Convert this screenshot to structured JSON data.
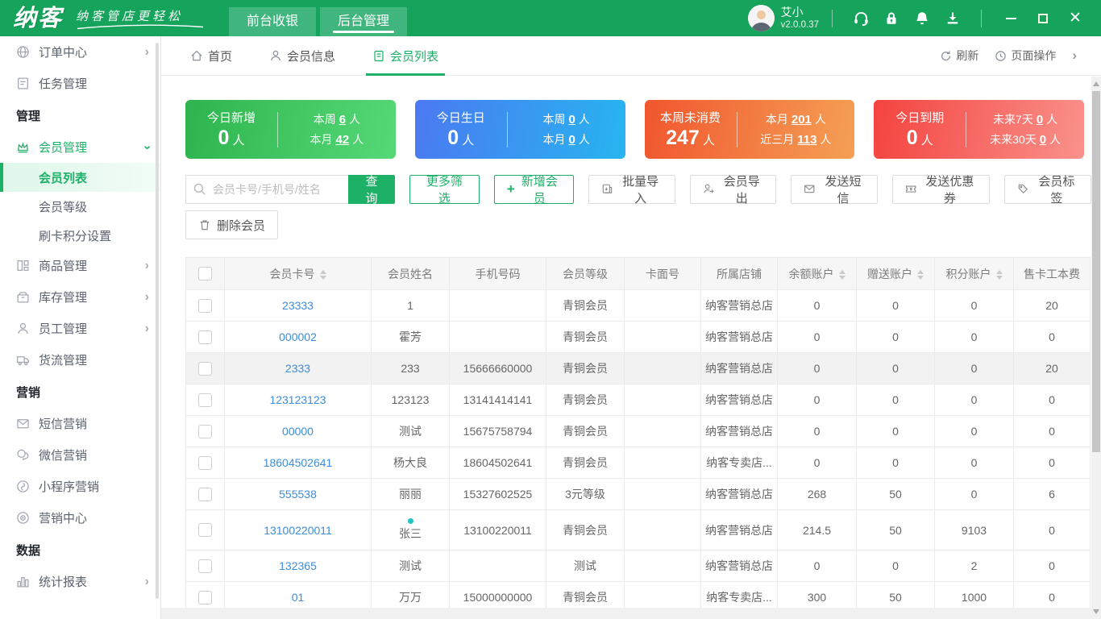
{
  "header": {
    "logo": "纳客",
    "tagline": "纳客管店更轻松",
    "nav": [
      {
        "label": "前台收银"
      },
      {
        "label": "后台管理"
      }
    ],
    "user_name": "艾小",
    "version": "v2.0.0.37"
  },
  "tabbar": {
    "tabs": [
      {
        "label": "首页"
      },
      {
        "label": "会员信息"
      },
      {
        "label": "会员列表"
      }
    ],
    "refresh": "刷新",
    "page_ops": "页面操作"
  },
  "sidebar": {
    "items": [
      {
        "type": "item",
        "key": "order-center",
        "icon": "globe-icon",
        "label": "订单中心",
        "chevron": true
      },
      {
        "type": "item",
        "key": "task-management",
        "icon": "document-icon",
        "label": "任务管理"
      },
      {
        "type": "section",
        "key": "management-section",
        "label": "管理"
      },
      {
        "type": "item",
        "key": "member-management",
        "icon": "crown-icon",
        "label": "会员管理",
        "chevron": true,
        "open": true
      },
      {
        "type": "subitem",
        "key": "member-list",
        "label": "会员列表",
        "active": true
      },
      {
        "type": "subitem",
        "key": "member-level",
        "label": "会员等级"
      },
      {
        "type": "subitem",
        "key": "card-points-setting",
        "label": "刷卡积分设置"
      },
      {
        "type": "item",
        "key": "goods-management",
        "icon": "goods-icon",
        "label": "商品管理",
        "chevron": true
      },
      {
        "type": "item",
        "key": "inventory-management",
        "icon": "box-icon",
        "label": "库存管理",
        "chevron": true
      },
      {
        "type": "item",
        "key": "staff-management",
        "icon": "person-icon",
        "label": "员工管理",
        "chevron": true
      },
      {
        "type": "item",
        "key": "logistics-management",
        "icon": "truck-icon",
        "label": "货流管理"
      },
      {
        "type": "section",
        "key": "marketing-section",
        "label": "营销"
      },
      {
        "type": "item",
        "key": "sms-marketing",
        "icon": "envelope-icon",
        "label": "短信营销"
      },
      {
        "type": "item",
        "key": "wechat-marketing",
        "icon": "wechat-icon",
        "label": "微信营销"
      },
      {
        "type": "item",
        "key": "miniapp-marketing",
        "icon": "miniapp-icon",
        "label": "小程序营销"
      },
      {
        "type": "item",
        "key": "marketing-center",
        "icon": "target-icon",
        "label": "营销中心"
      },
      {
        "type": "section",
        "key": "data-section",
        "label": "数据"
      },
      {
        "type": "item",
        "key": "statistics-report",
        "icon": "chart-icon",
        "label": "统计报表",
        "chevron": true
      }
    ]
  },
  "cards": [
    {
      "theme": "green",
      "title": "今日新增",
      "value": "0",
      "unit": "人",
      "stats": [
        {
          "label": "本周",
          "value": "6",
          "unit": "人"
        },
        {
          "label": "本月",
          "value": "42",
          "unit": "人"
        }
      ]
    },
    {
      "theme": "blue",
      "title": "今日生日",
      "value": "0",
      "unit": "人",
      "stats": [
        {
          "label": "本周",
          "value": "0",
          "unit": "人"
        },
        {
          "label": "本月",
          "value": "0",
          "unit": "人"
        }
      ]
    },
    {
      "theme": "orange",
      "title": "本周未消费",
      "value": "247",
      "unit": "人",
      "stats": [
        {
          "label": "本月",
          "value": "201",
          "unit": "人"
        },
        {
          "label": "近三月",
          "value": "113",
          "unit": "人"
        }
      ]
    },
    {
      "theme": "red",
      "title": "今日到期",
      "value": "0",
      "unit": "人",
      "stats": [
        {
          "label": "未来7天",
          "value": "0",
          "unit": "人"
        },
        {
          "label": "未来30天",
          "value": "0",
          "unit": "人"
        }
      ]
    }
  ],
  "toolbar": {
    "search_placeholder": "会员卡号/手机号/姓名",
    "query": "查询",
    "more_filter": "更多筛选",
    "add_plus": "+",
    "add_member": "新增会员",
    "batch_import": "批量导入",
    "member_export": "会员导出",
    "send_sms": "发送短信",
    "send_coupon": "发送优惠券",
    "member_tag": "会员标签",
    "delete_member": "删除会员"
  },
  "table": {
    "headers": [
      {
        "label": "会员卡号",
        "sortable": true
      },
      {
        "label": "会员姓名"
      },
      {
        "label": "手机号码"
      },
      {
        "label": "会员等级"
      },
      {
        "label": "卡面号"
      },
      {
        "label": "所属店铺"
      },
      {
        "label": "余额账户",
        "sortable": true
      },
      {
        "label": "赠送账户",
        "sortable": true
      },
      {
        "label": "积分账户",
        "sortable": true
      },
      {
        "label": "售卡工本费"
      }
    ],
    "rows": [
      {
        "card_no": "23333",
        "name": "1",
        "phone": "",
        "level": "青铜会员",
        "card_face": "",
        "store": "纳客营销总店",
        "balance": "0",
        "gift": "0",
        "points": "0",
        "fee": "20"
      },
      {
        "card_no": "000002",
        "name": "霍芳",
        "phone": "",
        "level": "青铜会员",
        "card_face": "",
        "store": "纳客营销总店",
        "balance": "0",
        "gift": "0",
        "points": "0",
        "fee": "0"
      },
      {
        "card_no": "2333",
        "name": "233",
        "phone": "15666660000",
        "level": "青铜会员",
        "card_face": "",
        "store": "纳客营销总店",
        "balance": "0",
        "gift": "0",
        "points": "0",
        "fee": "20",
        "shaded": true
      },
      {
        "card_no": "123123123",
        "name": "123123",
        "phone": "13141414141",
        "level": "青铜会员",
        "card_face": "",
        "store": "纳客营销总店",
        "balance": "0",
        "gift": "0",
        "points": "0",
        "fee": "0"
      },
      {
        "card_no": "00000",
        "name": "测试",
        "phone": "15675758794",
        "level": "青铜会员",
        "card_face": "",
        "store": "纳客营销总店",
        "balance": "0",
        "gift": "0",
        "points": "0",
        "fee": "0"
      },
      {
        "card_no": "18604502641",
        "name": "杨大良",
        "phone": "18604502641",
        "level": "青铜会员",
        "card_face": "",
        "store": "纳客专卖店...",
        "balance": "0",
        "gift": "0",
        "points": "0",
        "fee": "0"
      },
      {
        "card_no": "555538",
        "name": "丽丽",
        "phone": "15327602525",
        "level": "3元等级",
        "card_face": "",
        "store": "纳客营销总店",
        "balance": "268",
        "gift": "50",
        "points": "0",
        "fee": "6"
      },
      {
        "card_no": "13100220011",
        "name": "张三",
        "phone": "13100220011",
        "level": "青铜会员",
        "card_face": "",
        "store": "纳客营销总店",
        "balance": "214.5",
        "gift": "50",
        "points": "9103",
        "fee": "0",
        "dot": true
      },
      {
        "card_no": "132365",
        "name": "测试",
        "phone": "",
        "level": "测试",
        "card_face": "",
        "store": "纳客营销总店",
        "balance": "0",
        "gift": "0",
        "points": "2",
        "fee": "0"
      },
      {
        "card_no": "01",
        "name": "万万",
        "phone": "15000000000",
        "level": "青铜会员",
        "card_face": "",
        "store": "纳客专卖店...",
        "balance": "300",
        "gift": "50",
        "points": "1000",
        "fee": "0"
      }
    ]
  },
  "colors": {
    "brand_green": "#16a35c",
    "active_green": "#1db168",
    "link_blue": "#3c8ddc",
    "dot_teal": "#20c4c4"
  }
}
